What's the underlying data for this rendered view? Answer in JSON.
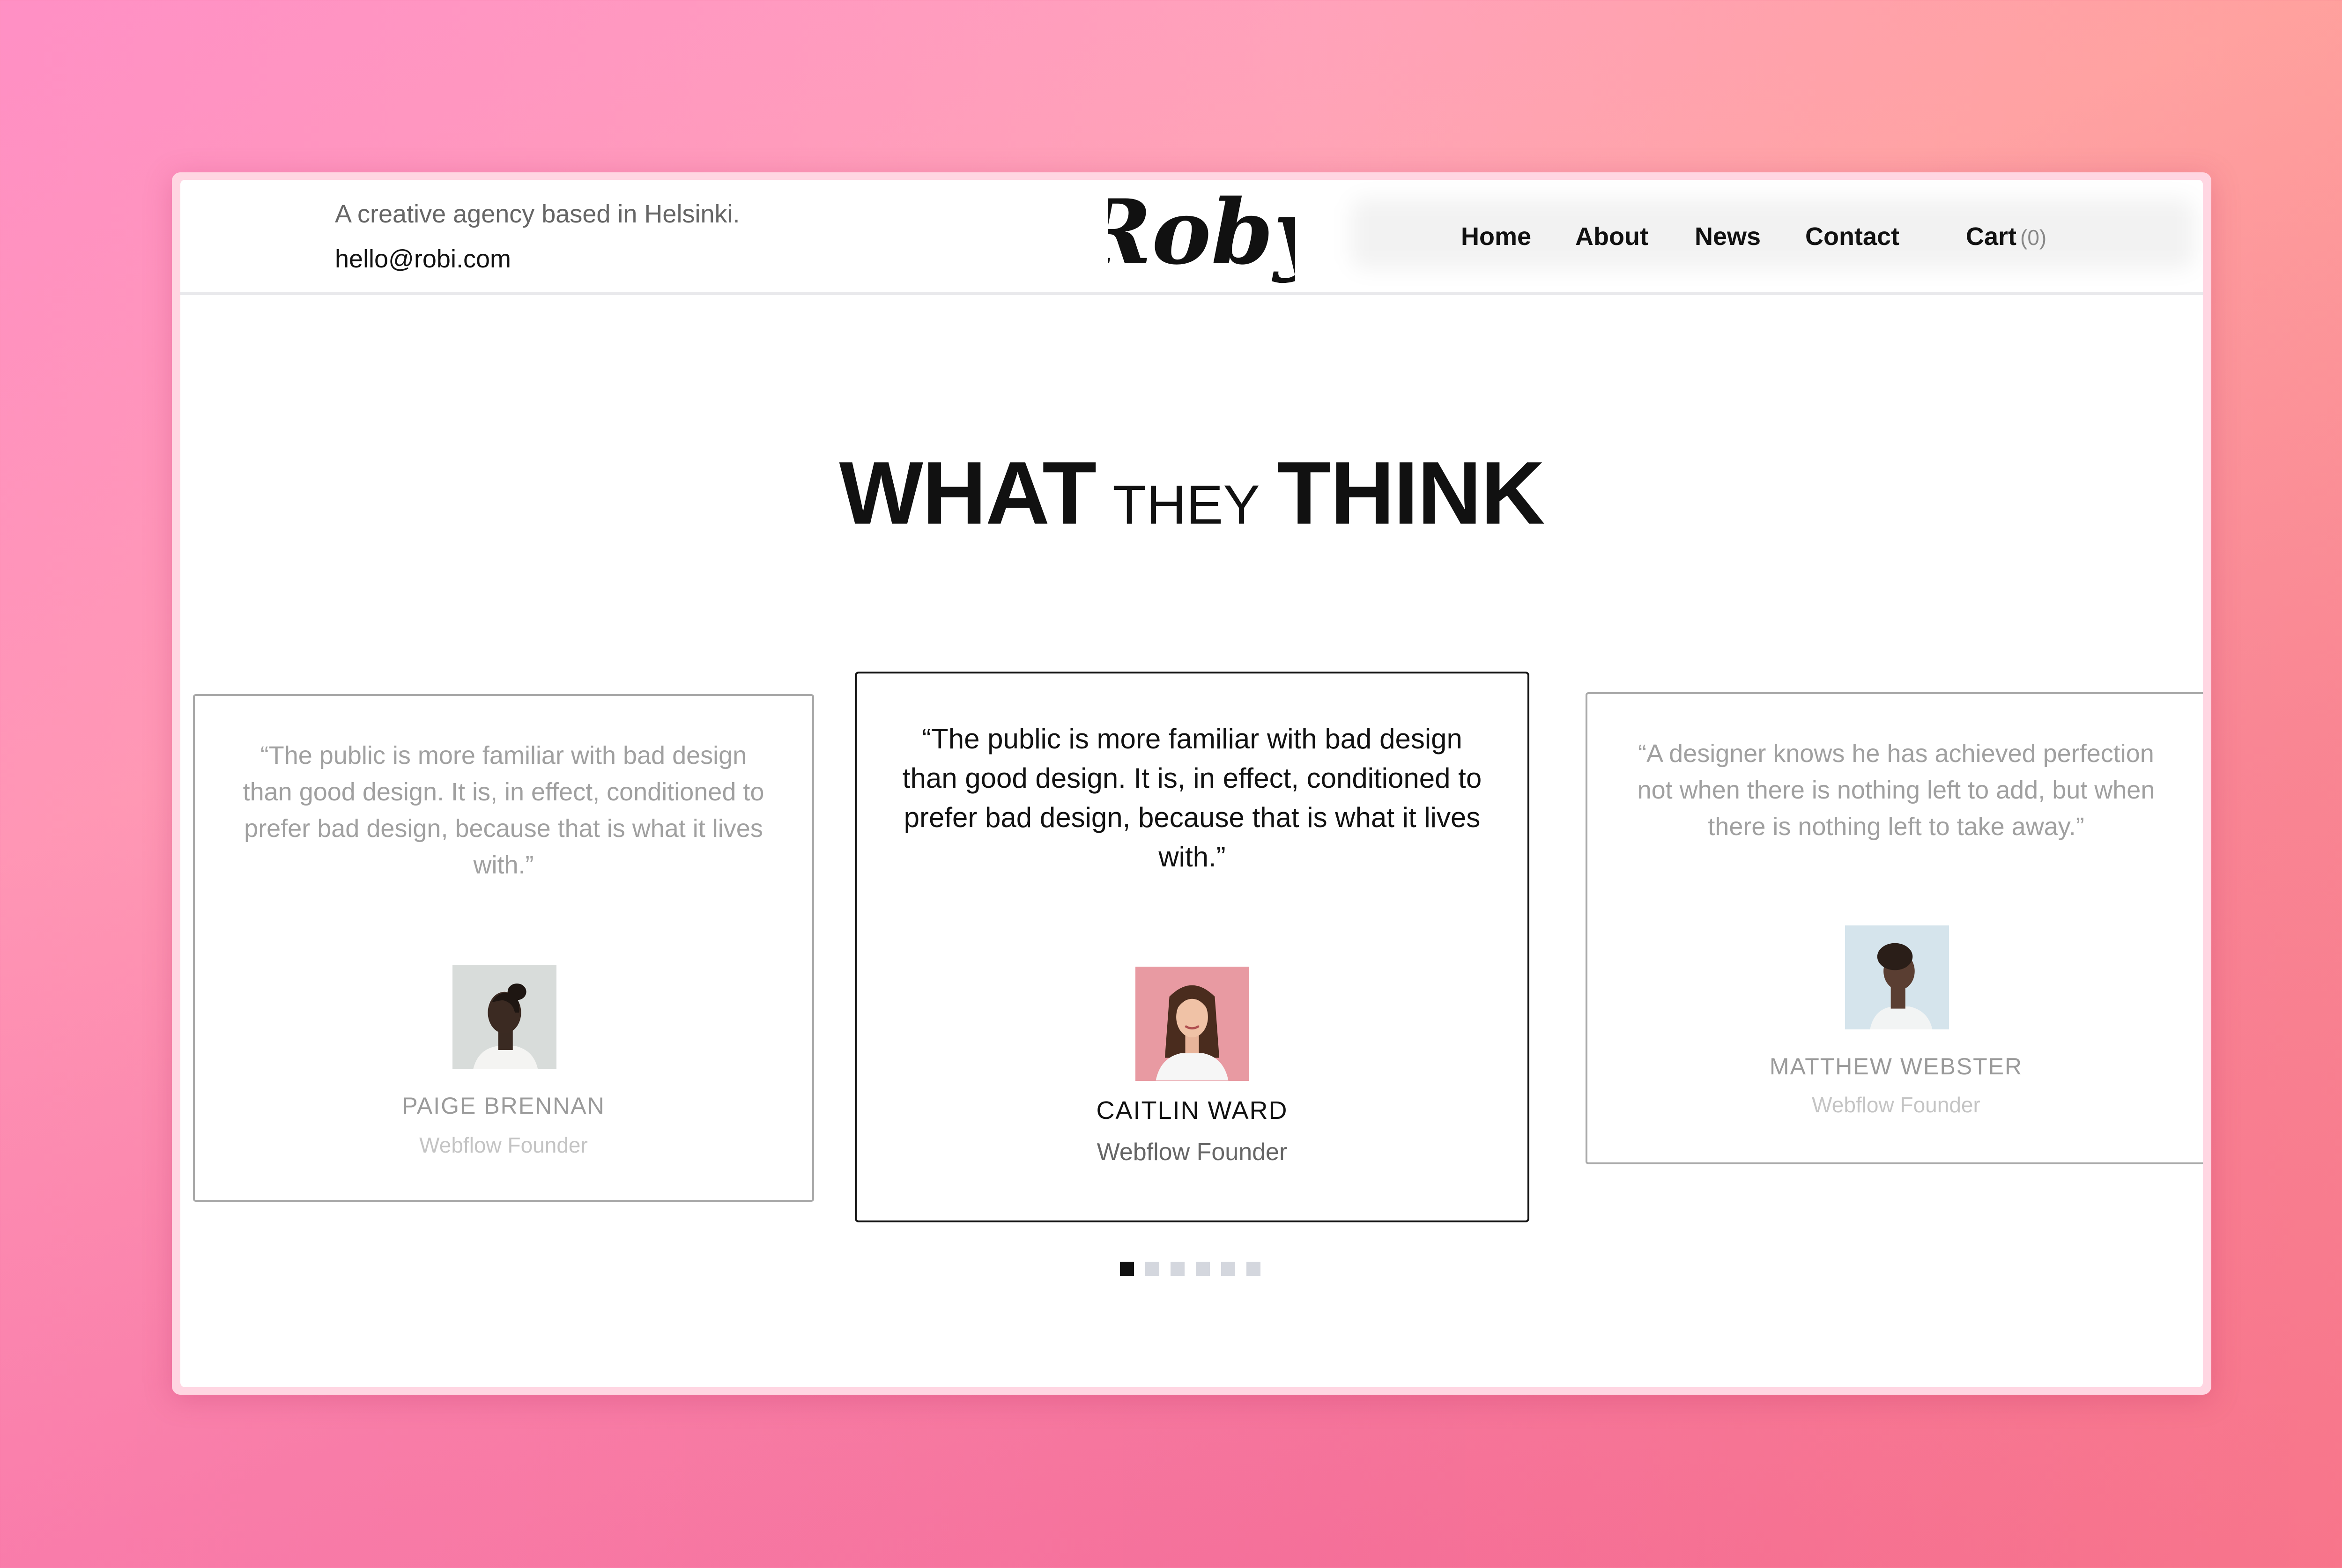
{
  "header": {
    "tagline": "A creative agency based in Helsinki.",
    "email": "hello@robi.com",
    "logo_text": "Roby",
    "nav": [
      {
        "label": "Home"
      },
      {
        "label": "About"
      },
      {
        "label": "News"
      },
      {
        "label": "Contact"
      }
    ],
    "cart": {
      "label": "Cart",
      "count": "(0)"
    }
  },
  "section": {
    "heading_part1": "WHAT",
    "heading_part2": "THEY",
    "heading_part3": "THINK"
  },
  "testimonials": [
    {
      "quote": "“The public is more familiar with bad design than good design. It is, in effect, conditioned to prefer bad design, because that is what it lives with.”",
      "name": "PAIGE  BRENNAN",
      "role": "Webflow Founder",
      "avatar_icon": "woman-profile-portrait",
      "state": "inactive"
    },
    {
      "quote": "“The public is more familiar with bad design than good design. It is, in effect, conditioned to prefer bad design, because that is what it lives with.”",
      "name": "CAITLIN  WARD",
      "role": "Webflow Founder",
      "avatar_icon": "smiling-woman-portrait",
      "state": "active"
    },
    {
      "quote": "“A designer knows he has achieved perfection not when there is nothing left to add, but when there is nothing left to take away.”",
      "name": "MATTHEW  WEBSTER",
      "role": "Webflow Founder",
      "avatar_icon": "man-profile-portrait",
      "state": "inactive"
    }
  ],
  "slider": {
    "dot_count": 6,
    "active_index": 0
  },
  "colors": {
    "active_dot": "#111111",
    "inactive_dot": "#d4d7de",
    "background_gradient": [
      "#ff9cc8",
      "#f46494"
    ]
  }
}
